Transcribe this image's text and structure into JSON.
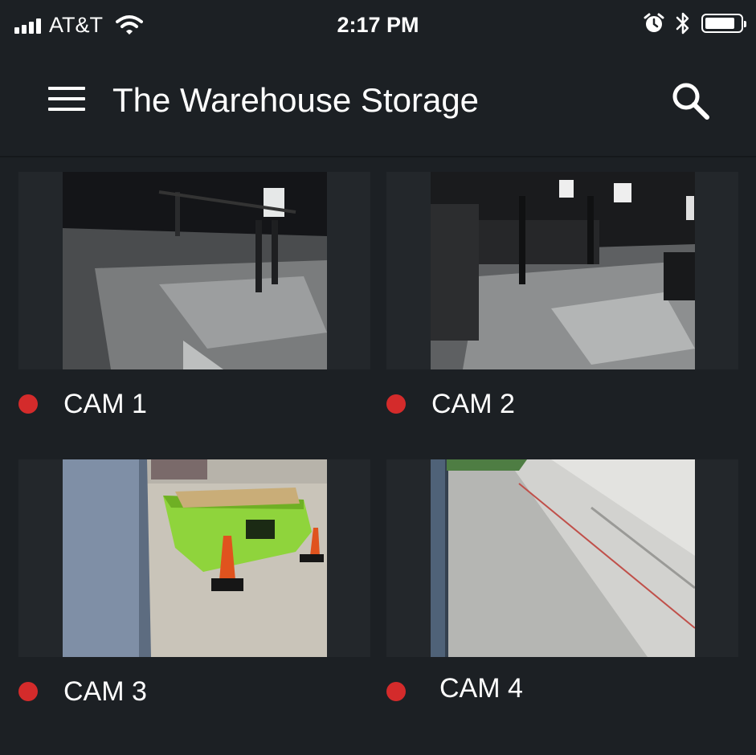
{
  "status_bar": {
    "carrier": "AT&T",
    "time": "2:17 PM",
    "battery_level": 0.85,
    "icons": [
      "signal-icon",
      "wifi-icon",
      "alarm-icon",
      "bluetooth-icon",
      "battery-icon"
    ]
  },
  "app_bar": {
    "title": "The Warehouse Storage",
    "icons": [
      "menu-icon",
      "search-icon"
    ]
  },
  "cameras": [
    {
      "name": "CAM 1",
      "status": "recording",
      "status_color": "#d42b2b"
    },
    {
      "name": "CAM 2",
      "status": "recording",
      "status_color": "#d42b2b"
    },
    {
      "name": "CAM 3",
      "status": "recording",
      "status_color": "#d42b2b"
    },
    {
      "name": "CAM 4",
      "status": "recording",
      "status_color": "#d42b2b"
    }
  ],
  "colors": {
    "background": "#1c2024",
    "tile": "#23272b",
    "recording": "#d42b2b"
  }
}
